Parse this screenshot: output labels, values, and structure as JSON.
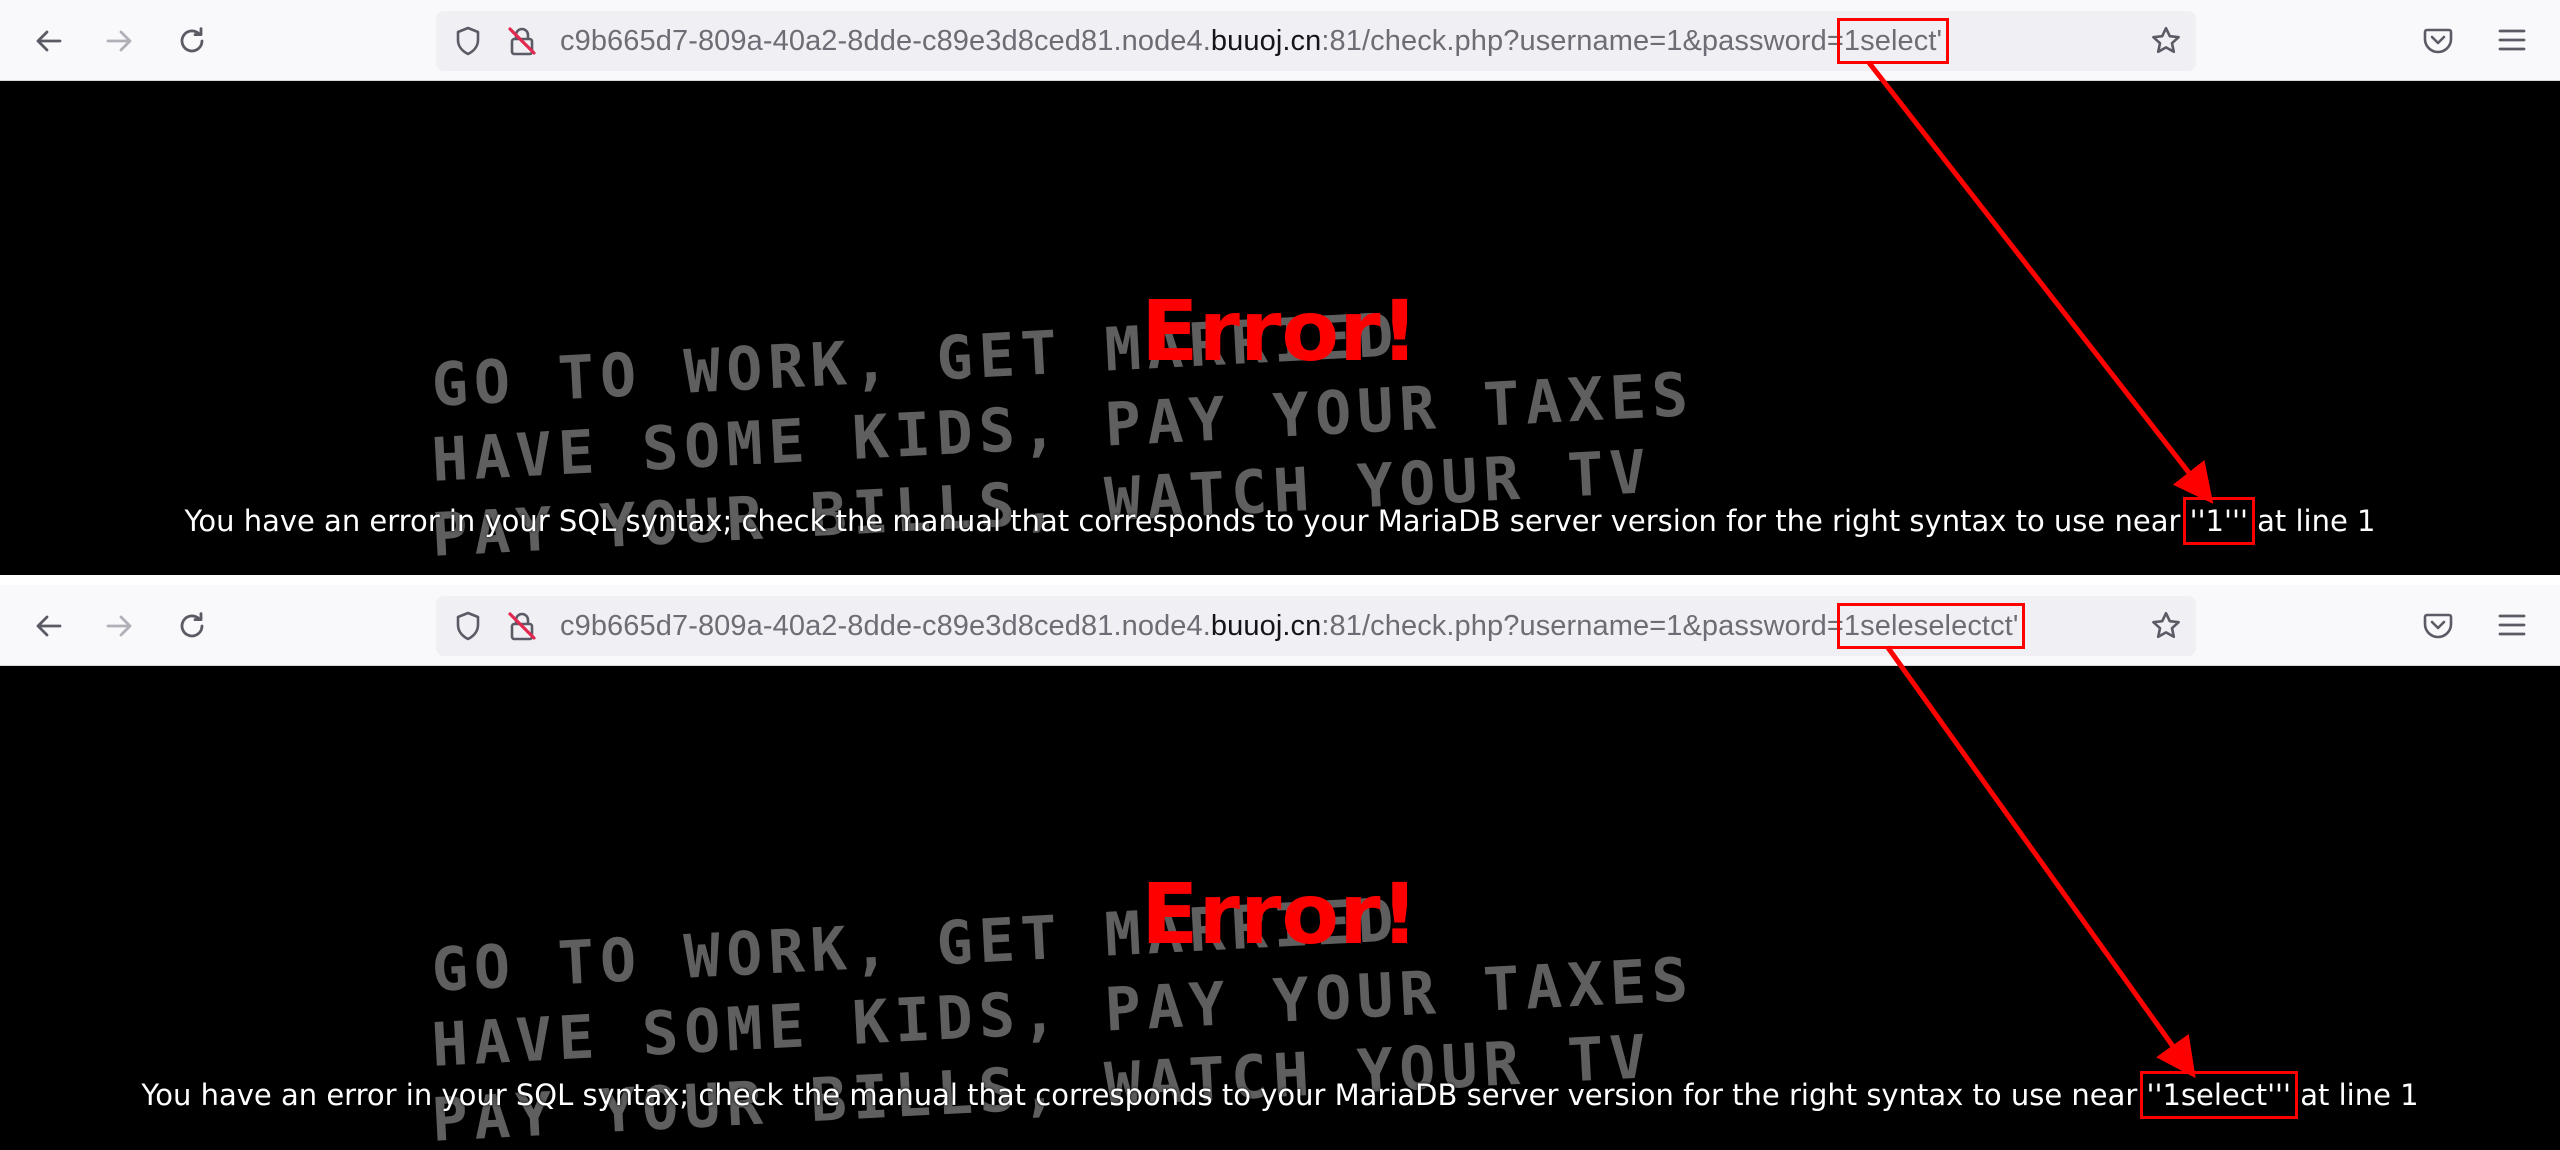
{
  "panels": [
    {
      "url_prefix": "c9b665d7-809a-40a2-8dde-c89e3d8ced81.node4.",
      "url_host": "buuoj.cn",
      "url_path": ":81/check.php?username=1&password=",
      "url_payload": "1select'",
      "error_title": "Error!",
      "error_msg_before": "You have an error in your SQL syntax; check the manual that corresponds to your MariaDB server version for the right syntax to use near ",
      "error_msg_highlight": "''1'''",
      "error_msg_after": " at line 1",
      "bg_lines": [
        "GO TO WORK, GET MARRIED",
        "HAVE SOME KIDS, PAY YOUR TAXES",
        "PAY YOUR BILLS, WATCH YOUR TV"
      ]
    },
    {
      "url_prefix": "c9b665d7-809a-40a2-8dde-c89e3d8ced81.node4.",
      "url_host": "buuoj.cn",
      "url_path": ":81/check.php?username=1&password=",
      "url_payload": "1seleselectct'",
      "error_title": "Error!",
      "error_msg_before": "You have an error in your SQL syntax; check the manual that corresponds to your MariaDB server version for the right syntax to use near ",
      "error_msg_highlight": "''1select'''",
      "error_msg_after": " at line 1",
      "bg_lines": [
        "GO TO WORK, GET MARRIED",
        "HAVE SOME KIDS, PAY YOUR TAXES",
        "PAY YOUR BILLS, WATCH YOUR TV"
      ]
    }
  ],
  "colors": {
    "error": "#ff0000",
    "annotation": "#ff0000",
    "toolbar": "#f9f9fb",
    "urlbar": "#f0f0f4"
  },
  "icons": [
    "back-arrow-icon",
    "forward-arrow-icon",
    "reload-icon",
    "shield-icon",
    "insecure-lock-icon",
    "bookmark-star-icon",
    "pocket-icon",
    "hamburger-menu-icon"
  ]
}
